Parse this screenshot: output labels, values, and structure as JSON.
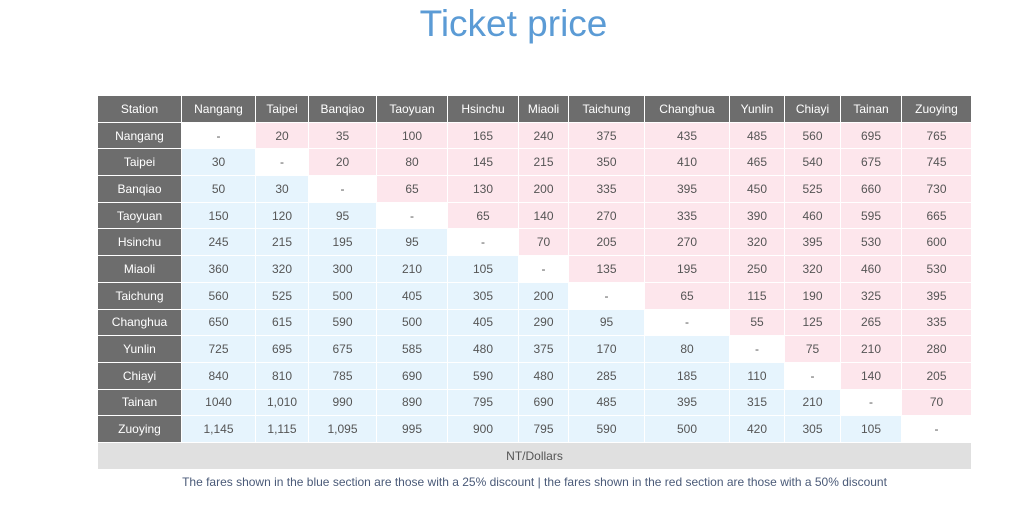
{
  "title": "Ticket price",
  "corner_label": "Station",
  "stations": [
    "Nangang",
    "Taipei",
    "Banqiao",
    "Taoyuan",
    "Hsinchu",
    "Miaoli",
    "Taichung",
    "Changhua",
    "Yunlin",
    "Chiayi",
    "Tainan",
    "Zuoying"
  ],
  "fares": [
    [
      "-",
      "20",
      "35",
      "100",
      "165",
      "240",
      "375",
      "435",
      "485",
      "560",
      "695",
      "765"
    ],
    [
      "30",
      "-",
      "20",
      "80",
      "145",
      "215",
      "350",
      "410",
      "465",
      "540",
      "675",
      "745"
    ],
    [
      "50",
      "30",
      "-",
      "65",
      "130",
      "200",
      "335",
      "395",
      "450",
      "525",
      "660",
      "730"
    ],
    [
      "150",
      "120",
      "95",
      "-",
      "65",
      "140",
      "270",
      "335",
      "390",
      "460",
      "595",
      "665"
    ],
    [
      "245",
      "215",
      "195",
      "95",
      "-",
      "70",
      "205",
      "270",
      "320",
      "395",
      "530",
      "600"
    ],
    [
      "360",
      "320",
      "300",
      "210",
      "105",
      "-",
      "135",
      "195",
      "250",
      "320",
      "460",
      "530"
    ],
    [
      "560",
      "525",
      "500",
      "405",
      "305",
      "200",
      "-",
      "65",
      "115",
      "190",
      "325",
      "395"
    ],
    [
      "650",
      "615",
      "590",
      "500",
      "405",
      "290",
      "95",
      "-",
      "55",
      "125",
      "265",
      "335"
    ],
    [
      "725",
      "695",
      "675",
      "585",
      "480",
      "375",
      "170",
      "80",
      "-",
      "75",
      "210",
      "280"
    ],
    [
      "840",
      "810",
      "785",
      "690",
      "590",
      "480",
      "285",
      "185",
      "110",
      "-",
      "140",
      "205"
    ],
    [
      "1040",
      "1,010",
      "990",
      "890",
      "795",
      "690",
      "485",
      "395",
      "315",
      "210",
      "-",
      "70"
    ],
    [
      "1,145",
      "1,115",
      "1,095",
      "995",
      "900",
      "795",
      "590",
      "500",
      "420",
      "305",
      "105",
      "-"
    ]
  ],
  "unit": "NT/Dollars",
  "note": "The fares shown in the blue section are those with a 25% discount | the fares shown in the red section are those with a 50% discount",
  "colors": {
    "title": "#5b9bd5",
    "header_bg": "#6d6d6d",
    "blue_section": "#e6f4fd",
    "red_section": "#fde6ec",
    "unit_bg": "#e0e0e0"
  }
}
